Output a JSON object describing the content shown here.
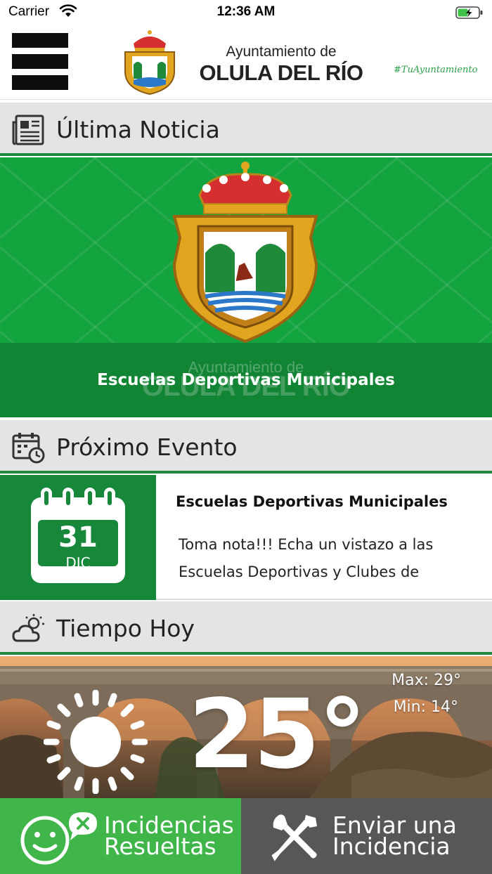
{
  "status_bar": {
    "carrier": "Carrier",
    "time": "12:36 AM",
    "wifi_icon": "wifi-icon",
    "battery_icon": "battery-charging-icon"
  },
  "header": {
    "menu_icon": "hamburger-menu-icon",
    "title_line1": "Ayuntamiento de",
    "title_line2": "OLULA DEL RÍO",
    "hashtag": "#TuAyuntamiento",
    "crest_icon": "coat-of-arms-icon"
  },
  "news": {
    "section_title": "Última Noticia",
    "icon": "newspaper-icon",
    "image_watermark_1": "Ayuntamiento de",
    "image_watermark_2": "OLULA DEL RÍO",
    "shield_label": "OLULA DEL RIO",
    "headline": "Escuelas Deportivas Municipales"
  },
  "event": {
    "section_title": "Próximo Evento",
    "icon": "calendar-clock-icon",
    "day": "31",
    "month": "DIC",
    "title": "Escuelas Deportivas Municipales",
    "description_line1": "Toma nota!!! Echa un vistazo a las",
    "description_line2": "Escuelas Deportivas y Clubes de"
  },
  "weather": {
    "section_title": "Tiempo Hoy",
    "icon": "partly-cloudy-icon",
    "max": "Max: 29°",
    "min": "Min: 14°",
    "current": "25°",
    "condition_icon": "sun-icon"
  },
  "actions": {
    "resolved_line1": "Incidencias",
    "resolved_line2": "Resueltas",
    "resolved_icon": "smiley-tools-icon",
    "report_line1": "Enviar una",
    "report_line2": "Incidencia",
    "report_icon": "wrench-screwdriver-icon"
  },
  "colors": {
    "primary_green": "#1f8a3d",
    "bright_green": "#3fb54a",
    "dark_gray": "#575756",
    "section_bg": "#e4e4e4"
  }
}
